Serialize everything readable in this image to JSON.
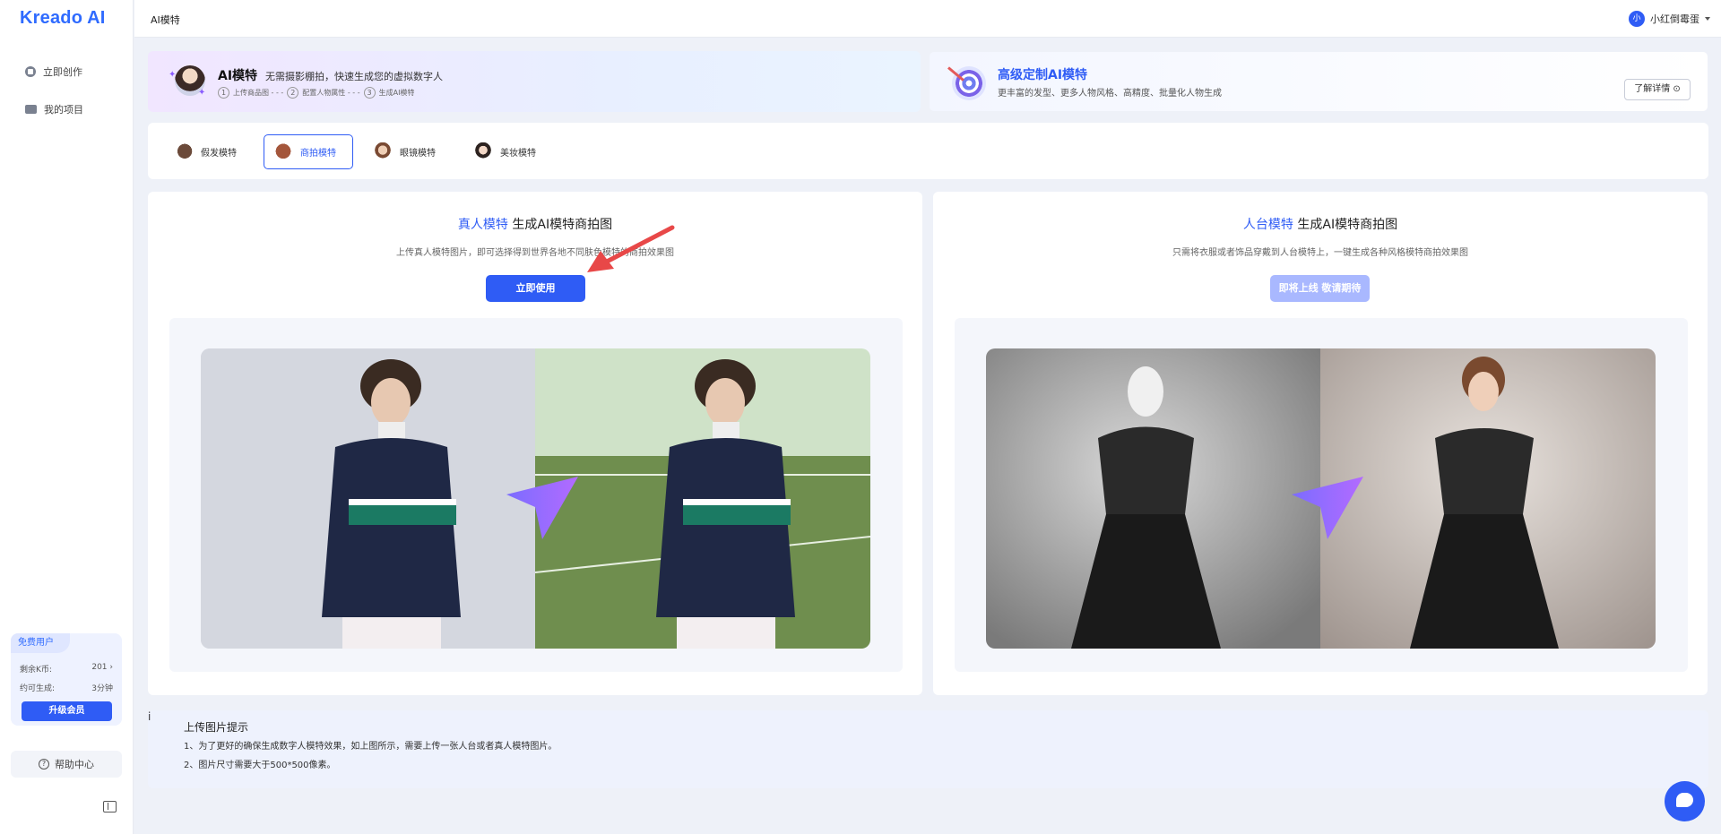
{
  "app": {
    "logo": "Kreado AI",
    "page_title": "AI模特"
  },
  "sidebar": {
    "items": [
      {
        "label": "立即创作",
        "icon": "create-icon"
      },
      {
        "label": "我的项目",
        "icon": "folder-icon"
      }
    ],
    "account": {
      "tag": "免费用户",
      "balance_label": "剩余K币:",
      "balance_value": "201 ›",
      "generate_label": "约可生成:",
      "generate_value": "3分钟",
      "upgrade_label": "升级会员"
    },
    "help_label": "帮助中心"
  },
  "user": {
    "avatar_text": "小",
    "name": "小红倒霉蛋"
  },
  "banner_left": {
    "title": "AI模特",
    "subtitle": "无需摄影棚拍，快速生成您的虚拟数字人",
    "steps": [
      {
        "num": "1",
        "label": "上传商品图 - - -"
      },
      {
        "num": "2",
        "label": "配置人物属性 - - -"
      },
      {
        "num": "3",
        "label": "生成AI模特"
      }
    ]
  },
  "banner_right": {
    "title": "高级定制AI模特",
    "subtitle": "更丰富的发型、更多人物风格、高精度、批量化人物生成",
    "learn_more": "了解详情 ⊙"
  },
  "tabs": [
    {
      "label": "假发模特",
      "active": false
    },
    {
      "label": "商拍模特",
      "active": true
    },
    {
      "label": "眼镜模特",
      "active": false
    },
    {
      "label": "美妆模特",
      "active": false
    }
  ],
  "card_left": {
    "title_highlight": "真人模特",
    "title_rest": " 生成AI模特商拍图",
    "subtitle": "上传真人模特图片，即可选择得到世界各地不同肤色模特的商拍效果图",
    "button": "立即使用"
  },
  "card_right": {
    "title_highlight": "人台模特",
    "title_rest": " 生成AI模特商拍图",
    "subtitle": "只需将衣服或者饰品穿戴到人台模特上，一键生成各种风格模特商拍效果图",
    "button": "即将上线 敬请期待"
  },
  "tips": {
    "title": "上传图片提示",
    "lines": [
      "1、为了更好的确保生成数字人模特效果，如上图所示，需要上传一张人台或者真人模特图片。",
      "2、图片尺寸需要大于500*500像素。"
    ]
  },
  "colors": {
    "accent": "#2f5cf5",
    "background": "#eef1f8",
    "disabled": "#a9b8ff"
  }
}
